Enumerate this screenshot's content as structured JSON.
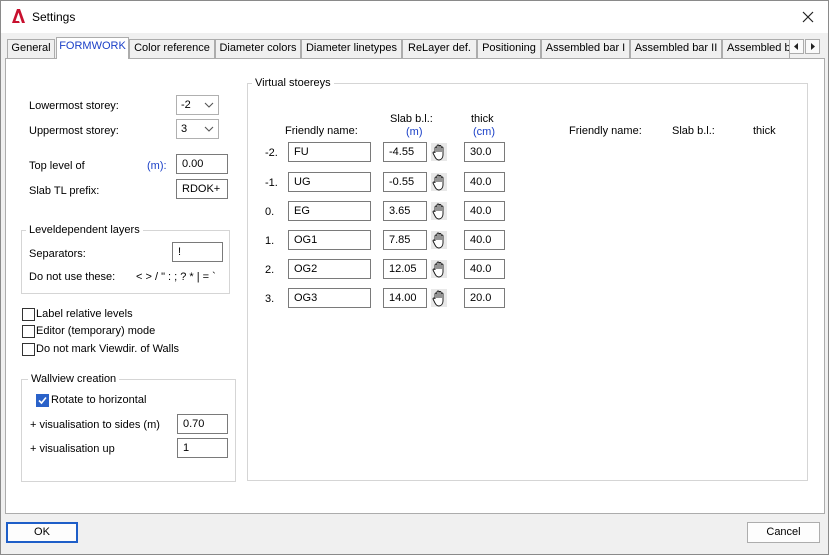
{
  "window": {
    "title": "Settings"
  },
  "tabs": [
    {
      "label": "General"
    },
    {
      "label": "FORMWORK"
    },
    {
      "label": "Color reference"
    },
    {
      "label": "Diameter colors"
    },
    {
      "label": "Diameter linetypes"
    },
    {
      "label": "ReLayer def."
    },
    {
      "label": "Positioning"
    },
    {
      "label": "Assembled bar I"
    },
    {
      "label": "Assembled bar II"
    },
    {
      "label": "Assembled b"
    }
  ],
  "active_tab": "FORMWORK",
  "left": {
    "lowermost_label": "Lowermost storey:",
    "lowermost_value": "-2",
    "uppermost_label": "Uppermost storey:",
    "uppermost_value": "3",
    "top_level_label": "Top level of",
    "top_level_unit": "(m):",
    "top_level_value": "0.00",
    "slab_prefix_label": "Slab TL prefix:",
    "slab_prefix_value": "RDOK+",
    "leveldependent": {
      "title": "Leveldependent layers",
      "separators_label": "Separators:",
      "separators_value": "!",
      "donotuse_label": "Do not use these:",
      "donotuse_chars": "< > / \" : ; ? * | = `"
    },
    "checkboxes": [
      {
        "label": "Label relative levels",
        "checked": false
      },
      {
        "label": "Editor (temporary) mode",
        "checked": false
      },
      {
        "label": "Do not mark Viewdir. of Walls",
        "checked": false
      }
    ],
    "wallview": {
      "title": "Wallview creation",
      "rotate_label": "Rotate to horizontal",
      "rotate_checked": true,
      "sides_label": "+ visualisation to sides (m)",
      "sides_value": "0.70",
      "up_label": "+ visualisation up",
      "up_value": "1"
    }
  },
  "virtual": {
    "title": "Virtual stoereys",
    "col_friendly": "Friendly name:",
    "col_slab": "Slab b.l.:",
    "col_slab_unit": "(m)",
    "col_thick": "thick",
    "col_thick_unit": "(cm)",
    "col2_friendly": "Friendly name:",
    "col2_slab": "Slab b.l.:",
    "col2_thick": "thick",
    "rows": [
      {
        "index": "-2.",
        "name": "FU",
        "slab": "-4.55",
        "thick": "30.0"
      },
      {
        "index": "-1.",
        "name": "UG",
        "slab": "-0.55",
        "thick": "40.0"
      },
      {
        "index": "0.",
        "name": "EG",
        "slab": "3.65",
        "thick": "40.0"
      },
      {
        "index": "1.",
        "name": "OG1",
        "slab": "7.85",
        "thick": "40.0"
      },
      {
        "index": "2.",
        "name": "OG2",
        "slab": "12.05",
        "thick": "40.0"
      },
      {
        "index": "3.",
        "name": "OG3",
        "slab": "14.00",
        "thick": "20.0"
      }
    ]
  },
  "buttons": {
    "ok": "OK",
    "cancel": "Cancel"
  },
  "colors": {
    "accent": "#1a3fc7",
    "checkbox": "#2a62c9",
    "app_icon": "#c8102e"
  }
}
